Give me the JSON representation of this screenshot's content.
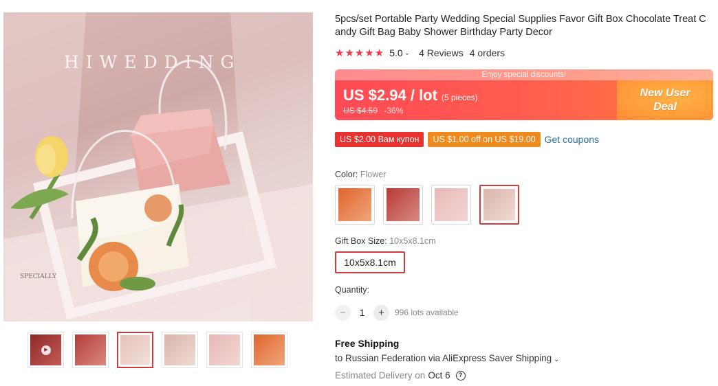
{
  "gallery": {
    "brand_text": "HIWEDDING",
    "caption": "SPECIALLY",
    "thumbnails": [
      {
        "name": "video",
        "colors": [
          "#8c2a2a",
          "#c45a55"
        ],
        "play": "▶"
      },
      {
        "name": "red",
        "colors": [
          "#b43b36",
          "#d98a80"
        ]
      },
      {
        "name": "flower",
        "colors": [
          "#e6c0bb",
          "#f3e0da"
        ]
      },
      {
        "name": "flower-box",
        "colors": [
          "#d9b3a9",
          "#efdcd4"
        ]
      },
      {
        "name": "pink",
        "colors": [
          "#e7b8b6",
          "#f2d7d4"
        ]
      },
      {
        "name": "orange",
        "colors": [
          "#e0652f",
          "#f0a67a"
        ]
      }
    ]
  },
  "product": {
    "title": "5pcs/set Portable Party Wedding Special Supplies Favor Gift Box Chocolate Treat Candy Gift Bag Baby Shower Birthday Party Decor",
    "stars": "★★★★★",
    "rating": "5.0",
    "rating_caret": "⌄",
    "reviews": "4 Reviews",
    "orders": "4 orders"
  },
  "price": {
    "banner": "Enjoy special discounts!",
    "current": "US $2.94 / lot",
    "pieces": "(5 pieces)",
    "original": "US $4.59",
    "discount": "-36%",
    "deal_line1": "New User",
    "deal_line2": "Deal"
  },
  "coupons": {
    "coupon1": "US $2.00 Вам купон",
    "coupon2": "US $1.00 off on US $19.00",
    "get": "Get coupons"
  },
  "options": {
    "color_label": "Color:",
    "color_value": "Flower",
    "swatches": [
      {
        "name": "orange",
        "colors": [
          "#e0652f",
          "#f0a67a"
        ]
      },
      {
        "name": "red",
        "colors": [
          "#b43b36",
          "#d98a80"
        ]
      },
      {
        "name": "pink",
        "colors": [
          "#e7b8b6",
          "#f2d7d4"
        ]
      },
      {
        "name": "flower",
        "colors": [
          "#d9b3a9",
          "#efdcd4"
        ]
      }
    ],
    "size_label": "Gift Box Size:",
    "size_value": "10x5x8.1cm",
    "size_option": "10x5x8.1cm",
    "quantity_label": "Quantity:",
    "minus": "−",
    "plus": "+",
    "quantity": "1",
    "available": "996 lots available"
  },
  "shipping": {
    "title": "Free Shipping",
    "destination": "to Russian Federation via AliExpress Saver Shipping",
    "caret": "⌄",
    "delivery_label": "Estimated Delivery on",
    "delivery_date": "Oct 6",
    "help": "?"
  },
  "colors": {
    "accent": "#d03a3a",
    "price_start": "#ff4a55",
    "price_end": "#ff7b3e",
    "star": "#f2394f",
    "link": "#2e6fa8"
  }
}
